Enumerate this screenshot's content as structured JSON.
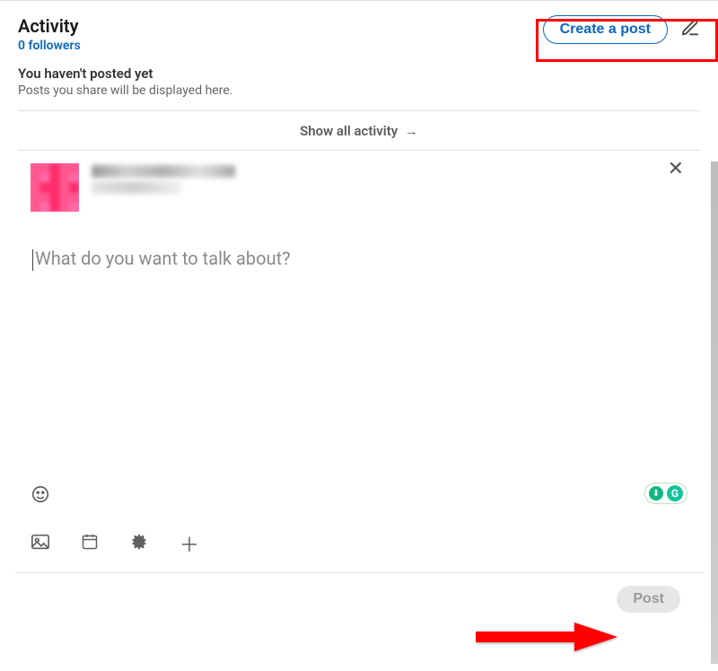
{
  "activity": {
    "title": "Activity",
    "followers": "0 followers",
    "create_post_label": "Create a post",
    "empty_title": "You haven't posted yet",
    "empty_sub": "Posts you share will be displayed here.",
    "show_all": "Show all activity"
  },
  "compose": {
    "placeholder": "What do you want to talk about?",
    "post_label": "Post",
    "grammarly_letter": "G",
    "grammarly_drop": "⬇"
  },
  "icons": {
    "arrow_right": "→",
    "close": "✕",
    "plus": "＋"
  }
}
